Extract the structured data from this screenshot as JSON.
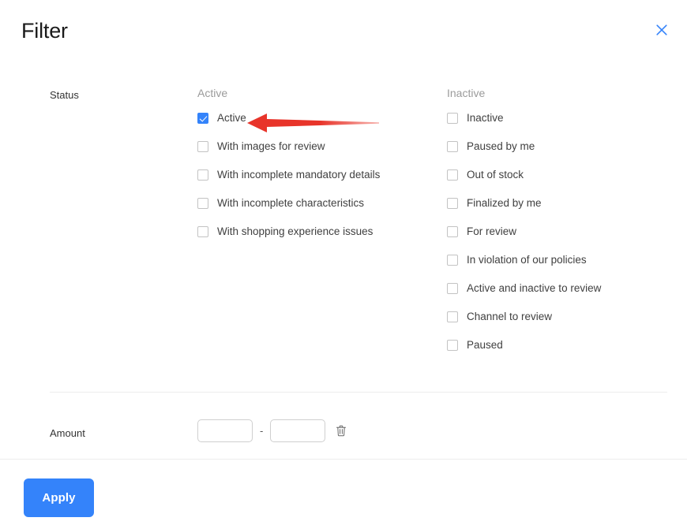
{
  "panel": {
    "title": "Filter",
    "close_icon": "close-icon"
  },
  "status_section": {
    "label": "Status",
    "columns": [
      {
        "header": "Active",
        "options": [
          {
            "label": "Active",
            "checked": true
          },
          {
            "label": "With images for review",
            "checked": false
          },
          {
            "label": "With incomplete mandatory details",
            "checked": false
          },
          {
            "label": "With incomplete characteristics",
            "checked": false
          },
          {
            "label": "With shopping experience issues",
            "checked": false
          }
        ]
      },
      {
        "header": "Inactive",
        "options": [
          {
            "label": "Inactive",
            "checked": false
          },
          {
            "label": "Paused by me",
            "checked": false
          },
          {
            "label": "Out of stock",
            "checked": false
          },
          {
            "label": "Finalized by me",
            "checked": false
          },
          {
            "label": "For review",
            "checked": false
          },
          {
            "label": "In violation of our policies",
            "checked": false
          },
          {
            "label": "Active and inactive to review",
            "checked": false
          },
          {
            "label": "Channel to review",
            "checked": false
          },
          {
            "label": "Paused",
            "checked": false
          }
        ]
      }
    ]
  },
  "amount_section": {
    "label": "Amount",
    "min_value": "",
    "max_value": "",
    "min_placeholder": "",
    "max_placeholder": "",
    "separator": "-",
    "clear_icon": "trash-icon"
  },
  "footer": {
    "apply_label": "Apply"
  },
  "annotation": {
    "type": "arrow",
    "direction": "left",
    "target": "Active",
    "color": "#e8342a"
  },
  "colors": {
    "accent": "#3483fa",
    "checkbox_border": "#c3c3c3",
    "label_text": "#404040",
    "column_header": "#9b9b9b",
    "divider": "#ededed",
    "annotation_red": "#e8342a"
  }
}
